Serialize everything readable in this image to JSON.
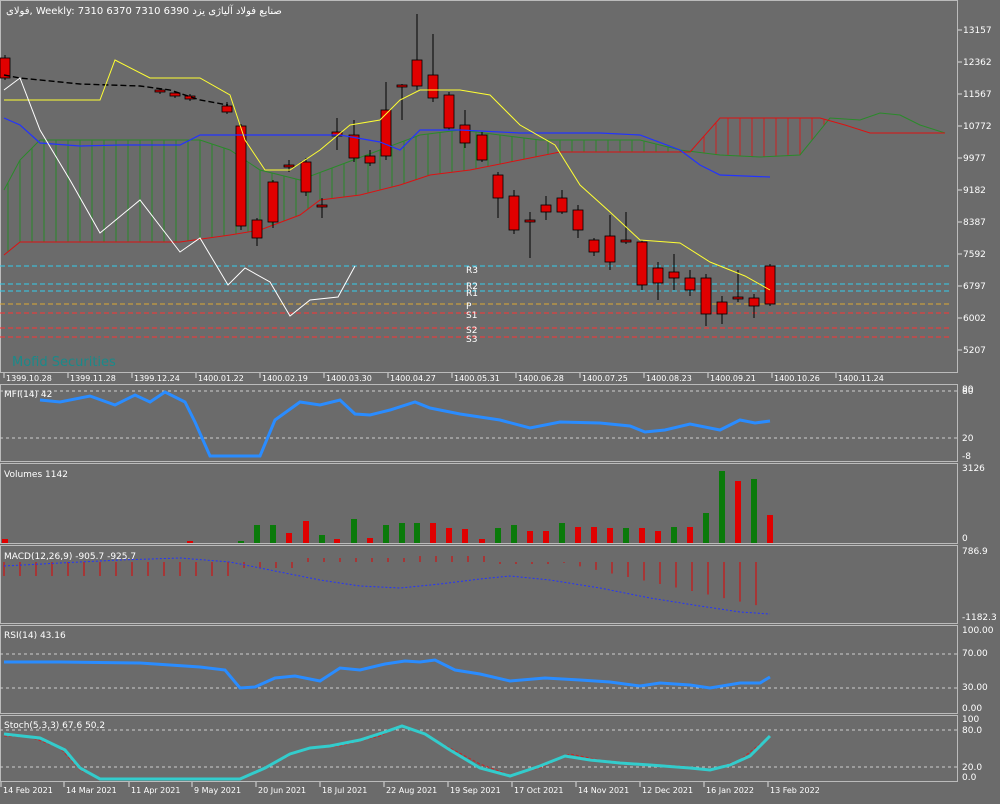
{
  "main": {
    "symbol": "فولای",
    "timeframe": "Weekly",
    "ohlc": "7310 6370 7310 6390",
    "company": "صنایع فولاد آلیاژی یزد",
    "watermark": "Mofid Securities",
    "price_ticks": [
      "13157",
      "12362",
      "11567",
      "10772",
      "9977",
      "9182",
      "8387",
      "7592",
      "6797",
      "6002",
      "5207"
    ],
    "date_ticks": [
      "1399.10.28",
      "1399.11.28",
      "1399.12.24",
      "1400.01.22",
      "1400.02.19",
      "1400.03.30",
      "1400.04.27",
      "1400.05.31",
      "1400.06.28",
      "1400.07.25",
      "1400.08.23",
      "1400.09.21",
      "1400.10.26",
      "1400.11.24"
    ],
    "pivots": [
      "R3",
      "R2",
      "R1",
      "P",
      "S1",
      "S2",
      "S3"
    ]
  },
  "mfi": {
    "label": "MFI(14) 42",
    "ticks": [
      "80",
      "80",
      "20",
      "-8"
    ]
  },
  "volumes": {
    "label": "Volumes 1142",
    "ticks": [
      "3126",
      "0"
    ]
  },
  "macd": {
    "label": "MACD(12,26,9) -905.7 -925.7",
    "ticks": [
      "786.9",
      "-1182.3"
    ]
  },
  "rsi": {
    "label": "RSI(14) 43.16",
    "ticks": [
      "100.00",
      "70.00",
      "30.00",
      "0.00"
    ]
  },
  "stoch": {
    "label": "Stoch(5,3,3) 67.6 50.2",
    "ticks": [
      "100",
      "80.0",
      "20.0",
      "0.0"
    ]
  },
  "bottom_dates": [
    "14 Feb 2021",
    "14 Mar 2021",
    "11 Apr 2021",
    "9 May 2021",
    "20 Jun 2021",
    "18 Jul 2021",
    "22 Aug 2021",
    "19 Sep 2021",
    "17 Oct 2021",
    "14 Nov 2021",
    "12 Dec 2021",
    "16 Jan 2022",
    "13 Feb 2022"
  ],
  "colors": {
    "bg": "#6b6b6b",
    "bull": "#0a7a0a",
    "bear": "#e00000",
    "tenkan": "#ffff33",
    "kijun": "#2233ff",
    "chikou": "#ffffff",
    "mfi_line": "#2a8cff",
    "rsi_line": "#2a8cff",
    "stoch_main": "#33cccc",
    "stoch_signal": "#cc2222",
    "pivot_blue": "#33ccee",
    "pivot_red": "#ff3333"
  }
}
